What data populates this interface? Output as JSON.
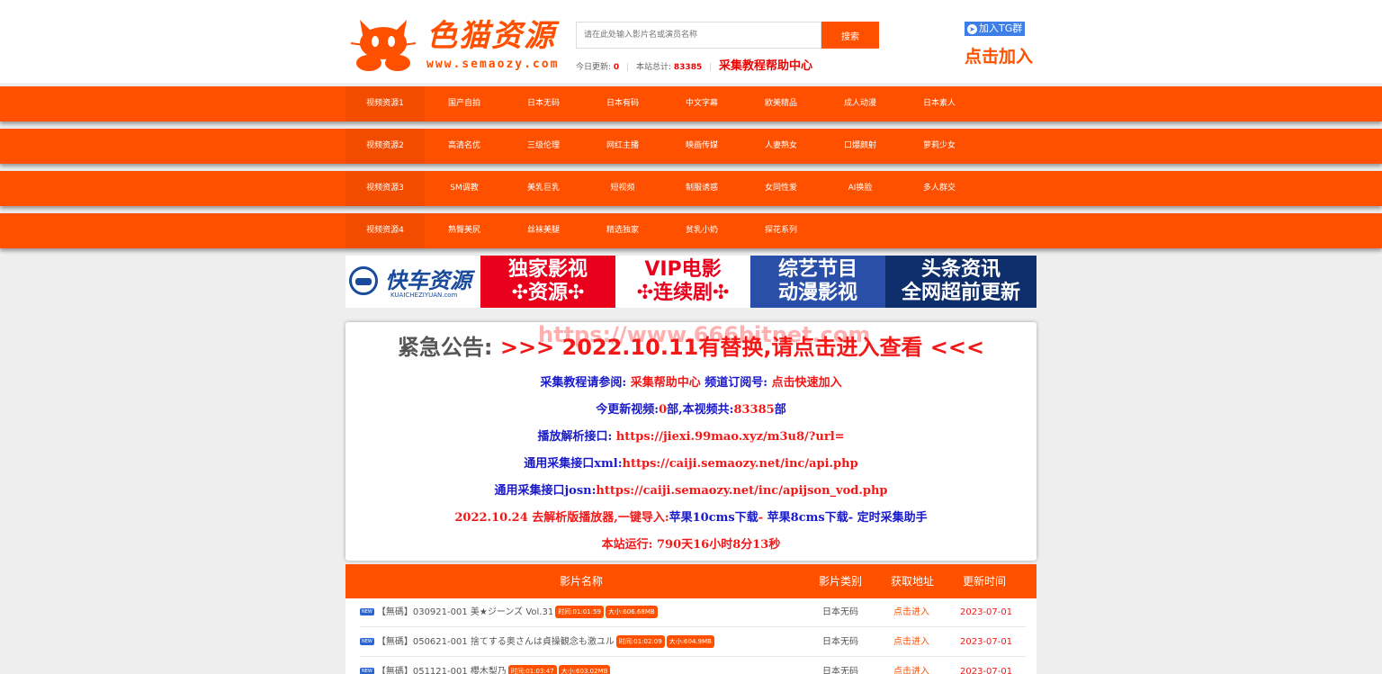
{
  "header": {
    "logo_title": "色猫资源",
    "logo_url": "www.semaozy.com",
    "search_placeholder": "请在此处输入影片名或演员名称",
    "search_button": "搜索",
    "stats": {
      "today_label": "今日更新:",
      "today_value": "0",
      "total_label": "本站总计:",
      "total_value": "83385",
      "help_link": "采集教程帮助中心"
    },
    "tg_button": "加入TG群",
    "join_link": "点击加入"
  },
  "nav": [
    {
      "items": [
        "视频资源1",
        "国产自拍",
        "日本无码",
        "日本有码",
        "中文字幕",
        "欧美精品",
        "成人动漫",
        "日本素人"
      ]
    },
    {
      "items": [
        "视频资源2",
        "高清名优",
        "三级伦理",
        "网红主播",
        "映画传媒",
        "人妻熟女",
        "口爆颜射",
        "萝莉少女"
      ]
    },
    {
      "items": [
        "视频资源3",
        "SM调教",
        "美乳巨乳",
        "短视频",
        "制服诱惑",
        "女同性爱",
        "AI换脸",
        "多人群交"
      ]
    },
    {
      "items": [
        "视频资源4",
        "熟臀美尻",
        "丝袜美腿",
        "精选独家",
        "贫乳小奶",
        "探花系列"
      ]
    }
  ],
  "banner": {
    "brand": "快车资源",
    "brand_sub": "KUAICHEZIYUAN.com",
    "seg1_a": "独家影视",
    "seg1_b": "✣资源✣",
    "seg2_a": "VIP电影",
    "seg2_b": "✣连续剧✣",
    "seg3_a": "综艺节目",
    "seg3_b": "动漫影视",
    "seg4_a": "头条资讯",
    "seg4_b": "全网超前更新"
  },
  "notice": {
    "title_label": "紧急公告:",
    "title_link": ">>> 2022.10.11有替换,请点击进入查看 <<<",
    "watermark": "https://www.666bitnet.com",
    "line1_label": "采集教程请参阅:",
    "line1_link1": "采集帮助中心",
    "line1_mid": "频道订阅号:",
    "line1_link2": "点击快速加入",
    "line2_a": "今更新视频:",
    "line2_b": "0",
    "line2_c": "部,本视频共:",
    "line2_d": "83385",
    "line2_e": "部",
    "line3_label": "播放解析接口:",
    "line3_value": "https://jiexi.99mao.xyz/m3u8/?url=",
    "line4_label": "通用采集接口xml:",
    "line4_value": "https://caiji.semaozy.net/inc/api.php",
    "line5_label": "通用采集接口josn:",
    "line5_value": "https://caiji.semaozy.net/inc/apijson_vod.php",
    "line6_a": "2022.10.24 去解析版播放器,一键导入:",
    "line6_b": "苹果10cms下载",
    "line6_c": "- ",
    "line6_d": "苹果8cms下载",
    "line6_e": "- 定时采集助手",
    "line7_label": "本站运行:",
    "line7_value": "790天16小时8分13秒"
  },
  "table": {
    "headers": {
      "name": "影片名称",
      "category": "影片类别",
      "link": "获取地址",
      "updated": "更新时间"
    },
    "new_badge": "NEW",
    "rows": [
      {
        "title": "【無碼】030921-001 美★ジーンズ Vol.31",
        "time": "时间:01:01:59",
        "size": "大小:606.68MB",
        "category": "日本无码",
        "link": "点击进入",
        "date": "2023-07-01"
      },
      {
        "title": "【無碼】050621-001 捨てする奥さんは貞操観念も激ユル",
        "time": "时间:01:02:09",
        "size": "大小:604.9MB",
        "category": "日本无码",
        "link": "点击进入",
        "date": "2023-07-01"
      },
      {
        "title": "【無碼】051121-001 櫻木梨乃",
        "time": "时间:01:03:47",
        "size": "大小:603.02MB",
        "category": "日本无码",
        "link": "点击进入",
        "date": "2023-07-01"
      }
    ]
  },
  "colors": {
    "accent": "#ff5000",
    "notice_blue": "#1a1acb",
    "notice_red": "#f21818"
  }
}
